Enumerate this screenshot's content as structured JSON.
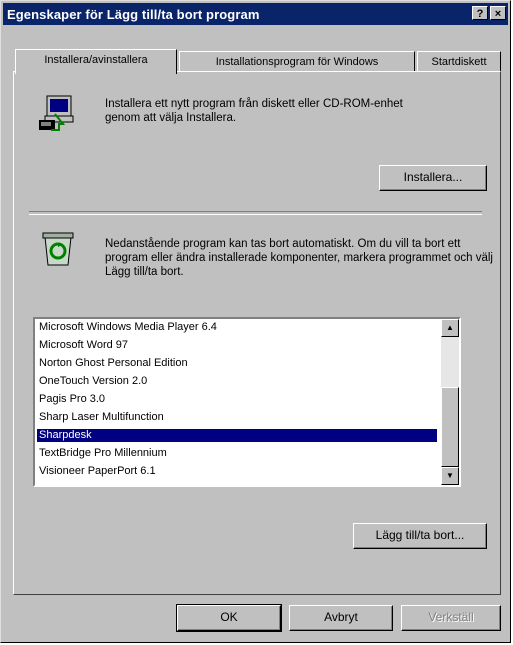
{
  "window": {
    "title": "Egenskaper för Lägg till/ta bort program",
    "help_label": "?",
    "close_label": "×"
  },
  "tabs": [
    {
      "label": "Installera/avinstallera",
      "active": true
    },
    {
      "label": "Installationsprogram för Windows",
      "active": false
    },
    {
      "label": "Startdiskett",
      "active": false
    }
  ],
  "install": {
    "description": "Installera ett nytt program från diskett eller CD-ROM-enhet genom att välja Installera.",
    "button_label": "Installera..."
  },
  "remove": {
    "description": "Nedanstående program kan tas bort automatiskt. Om du vill ta bort ett program eller ändra installerade komponenter, markera programmet och välj Lägg till/ta bort.",
    "button_label": "Lägg till/ta bort..."
  },
  "programs": {
    "items": [
      "Microsoft Windows Media Player 6.4",
      "Microsoft Word 97",
      "Norton Ghost Personal Edition",
      "OneTouch Version 2.0",
      "Pagis Pro 3.0",
      "Sharp Laser Multifunction",
      "Sharpdesk",
      "TextBridge Pro Millennium",
      "Visioneer PaperPort 6.1"
    ],
    "selected": "Sharpdesk",
    "scroll_up_label": "▲",
    "scroll_down_label": "▼"
  },
  "footer": {
    "ok_label": "OK",
    "cancel_label": "Avbryt",
    "apply_label": "Verkställ"
  }
}
